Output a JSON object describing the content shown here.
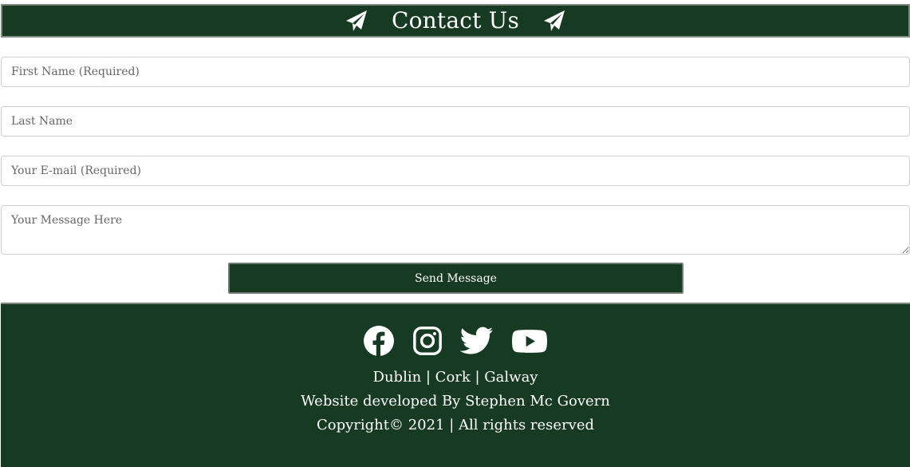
{
  "header": {
    "title": "Contact Us",
    "left_icon": "paper-plane-icon",
    "right_icon": "paper-plane-icon"
  },
  "form": {
    "first_name_placeholder": "First Name (Required)",
    "last_name_placeholder": "Last Name",
    "email_placeholder": "Your E-mail (Required)",
    "message_placeholder": "Your Message Here",
    "submit_label": "Send Message"
  },
  "footer": {
    "social": [
      "facebook-icon",
      "instagram-icon",
      "twitter-icon",
      "youtube-icon"
    ],
    "locations": "Dublin | Cork | Galway",
    "developer": "Website developed By Stephen Mc Govern",
    "copyright": "Copyright© 2021 | All rights reserved"
  },
  "colors": {
    "brand_green": "#173a22",
    "border_gray": "#7f8a83",
    "text_light": "#ffffff"
  }
}
